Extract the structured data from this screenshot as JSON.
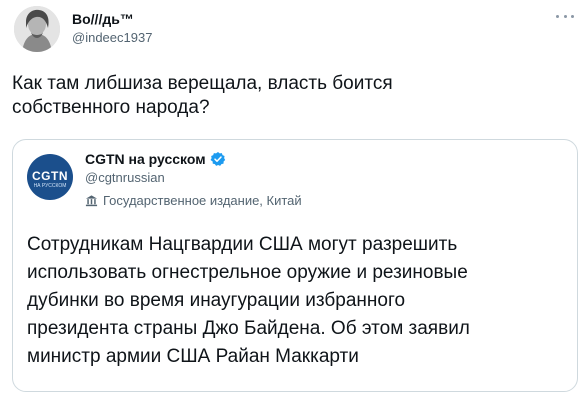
{
  "tweet": {
    "author": {
      "name": "Bo///дь™",
      "handle": "@indeec1937"
    },
    "text": "Как там либшиза верещала, власть боится\nсобственного народа?",
    "more_icon": "more-horizontal-icon"
  },
  "quoted_tweet": {
    "avatar_logo": "CGTN",
    "avatar_logo_sub": "НА РУССКОМ",
    "author": {
      "name": "CGTN на русском",
      "handle": "@cgtnrussian",
      "verified": true
    },
    "label_icon": "government-building-icon",
    "label": "Государственное издание, Китай",
    "text": "Сотрудникам Нацгвардии США могут разрешить\nиспользовать огнестрельное оружие и резиновые\nдубинки во время инаугурации избранного\nпрезидента страны Джо Байдена. Об этом заявил\nминистр армии США Райан Маккарти"
  },
  "colors": {
    "text_primary": "#0f1419",
    "text_secondary": "#536471",
    "border": "#cfd9de",
    "verified_blue": "#1d9bf0",
    "cgtn_blue": "#1b4f8c"
  }
}
